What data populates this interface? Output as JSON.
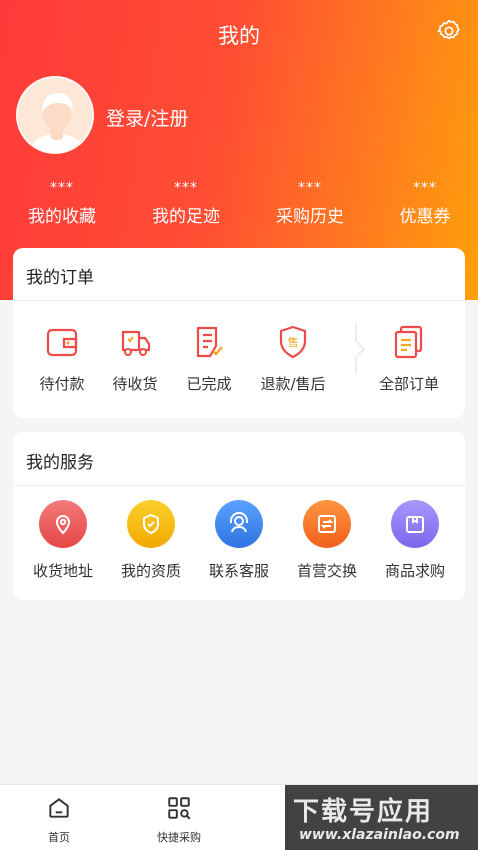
{
  "header": {
    "title": "我的",
    "login_label": "登录/注册"
  },
  "stats": [
    {
      "value": "***",
      "label": "我的收藏"
    },
    {
      "value": "***",
      "label": "我的足迹"
    },
    {
      "value": "***",
      "label": "采购历史"
    },
    {
      "value": "***",
      "label": "优惠券"
    }
  ],
  "orders": {
    "title": "我的订单",
    "items": [
      {
        "label": "待付款",
        "icon": "wallet-icon"
      },
      {
        "label": "待收货",
        "icon": "truck-icon"
      },
      {
        "label": "已完成",
        "icon": "completed-doc-icon"
      },
      {
        "label": "退款/售后",
        "icon": "after-sale-shield-icon"
      },
      {
        "label": "全部订单",
        "icon": "all-orders-icon"
      }
    ]
  },
  "services": {
    "title": "我的服务",
    "items": [
      {
        "label": "收货地址",
        "icon": "location-pin-icon",
        "color": "#ef5a5a"
      },
      {
        "label": "我的资质",
        "icon": "shield-check-icon",
        "color": "#f5b400"
      },
      {
        "label": "联系客服",
        "icon": "headset-icon",
        "color": "#3f8cf0"
      },
      {
        "label": "首营交换",
        "icon": "exchange-icon",
        "color": "#f7742a"
      },
      {
        "label": "商品求购",
        "icon": "box-icon",
        "color": "#8c7cf2"
      }
    ]
  },
  "tabbar": [
    {
      "label": "首页",
      "icon": "home-icon"
    },
    {
      "label": "快捷采购",
      "icon": "quick-purchase-icon"
    }
  ],
  "watermark": {
    "text": "下载号应用",
    "url_text": "www.xlazainlao.com"
  },
  "colors": {
    "accent": "#ff3a3a",
    "gradient_end": "#ffa00a"
  }
}
